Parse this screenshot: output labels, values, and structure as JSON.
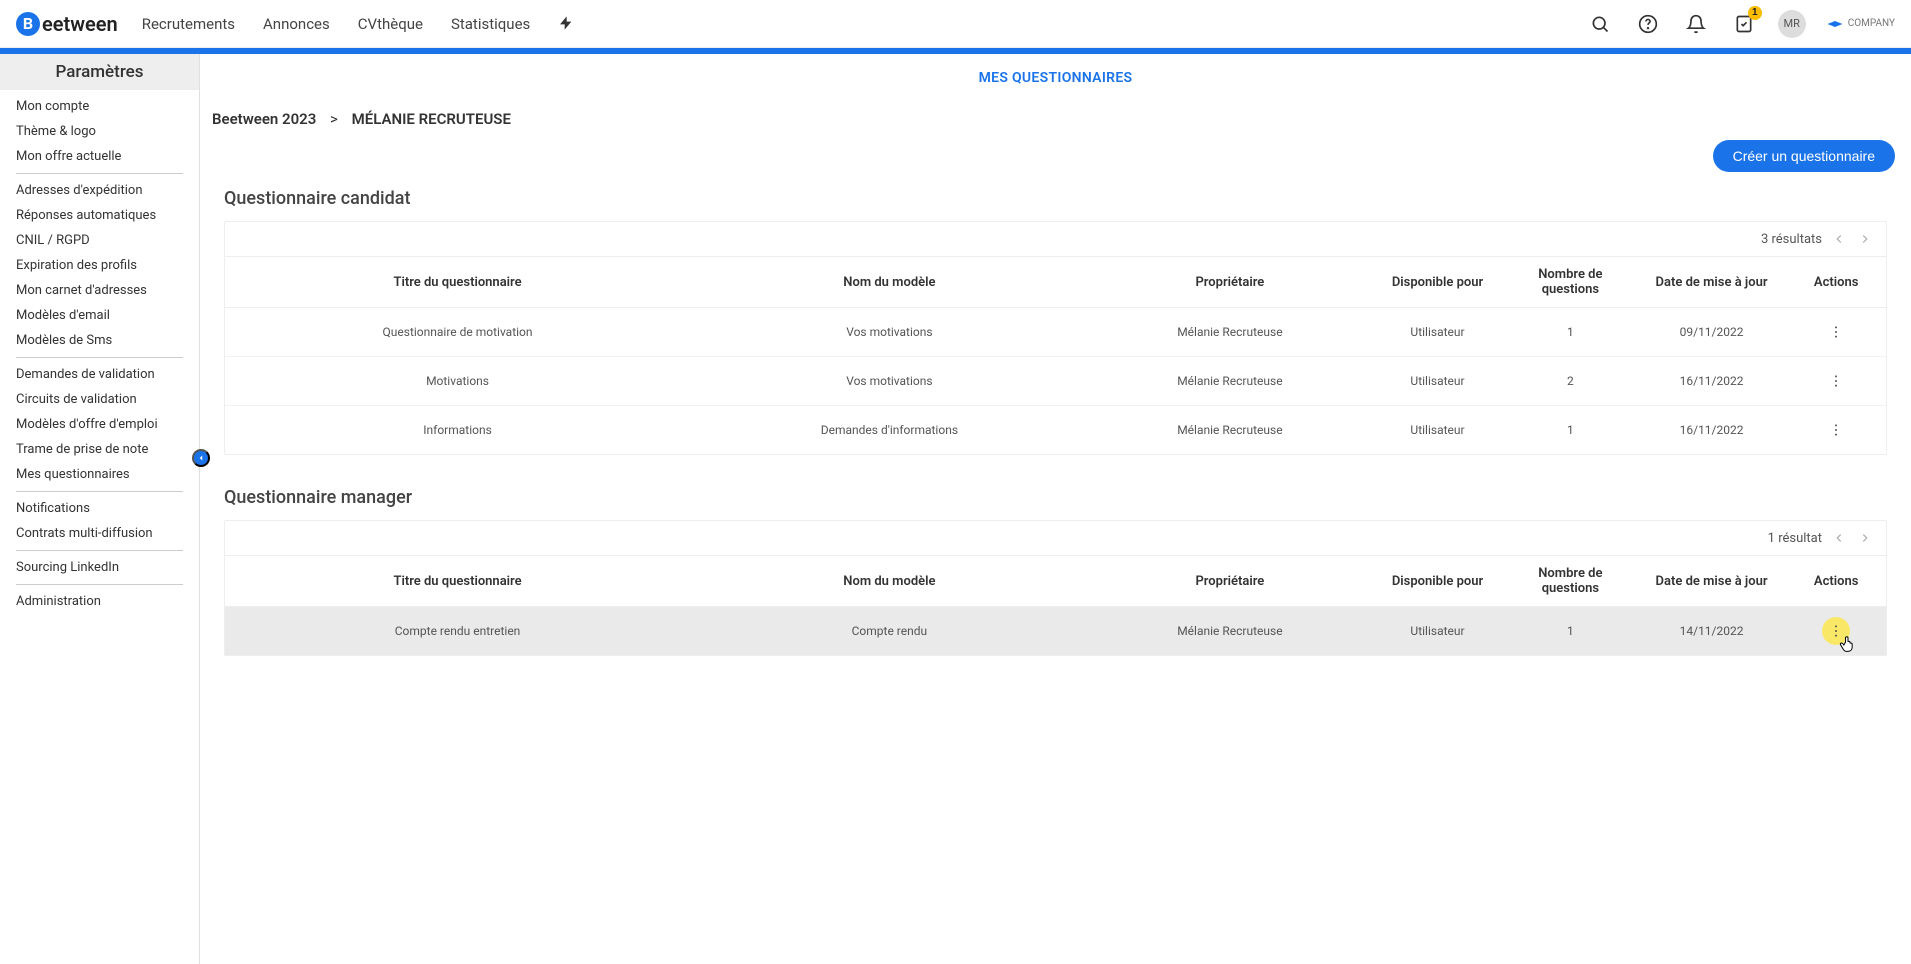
{
  "header": {
    "brand": "eetween",
    "nav": [
      "Recrutements",
      "Annonces",
      "CVthèque",
      "Statistiques"
    ],
    "badge_count": "1",
    "avatar_initials": "MR",
    "company_text": "COMPANY"
  },
  "sidebar": {
    "title": "Paramètres",
    "groups": [
      [
        "Mon compte",
        "Thème & logo",
        "Mon offre actuelle"
      ],
      [
        "Adresses d'expédition",
        "Réponses automatiques",
        "CNIL / RGPD",
        "Expiration des profils",
        "Mon carnet d'adresses",
        "Modèles d'email",
        "Modèles de Sms"
      ],
      [
        "Demandes de validation",
        "Circuits de validation",
        "Modèles d'offre d'emploi",
        "Trame de prise de note",
        "Mes questionnaires"
      ],
      [
        "Notifications",
        "Contrats multi-diffusion"
      ],
      [
        "Sourcing LinkedIn"
      ],
      [
        "Administration"
      ]
    ]
  },
  "main": {
    "tab_label": "MES QUESTIONNAIRES",
    "breadcrumb": {
      "org": "Beetween 2023",
      "sep": ">",
      "user": "MÉLANIE RECRUTEUSE"
    },
    "create_btn": "Créer un questionnaire",
    "columns": {
      "title": "Titre du questionnaire",
      "model": "Nom du modèle",
      "owner": "Propriétaire",
      "available": "Disponible pour",
      "nq": "Nombre de questions",
      "date": "Date de mise à jour",
      "actions": "Actions"
    },
    "sections": [
      {
        "heading": "Questionnaire candidat",
        "results_label": "3 résultats",
        "rows": [
          {
            "title": "Questionnaire de motivation",
            "model": "Vos motivations",
            "owner": "Mélanie Recruteuse",
            "avail": "Utilisateur",
            "nq": "1",
            "date": "09/11/2022"
          },
          {
            "title": "Motivations",
            "model": "Vos motivations",
            "owner": "Mélanie Recruteuse",
            "avail": "Utilisateur",
            "nq": "2",
            "date": "16/11/2022"
          },
          {
            "title": "Informations",
            "model": "Demandes d'informations",
            "owner": "Mélanie Recruteuse",
            "avail": "Utilisateur",
            "nq": "1",
            "date": "16/11/2022"
          }
        ]
      },
      {
        "heading": "Questionnaire manager",
        "results_label": "1 résultat",
        "rows": [
          {
            "title": "Compte rendu entretien",
            "model": "Compte rendu",
            "owner": "Mélanie Recruteuse",
            "avail": "Utilisateur",
            "nq": "1",
            "date": "14/11/2022",
            "highlighted": true
          }
        ]
      }
    ]
  }
}
